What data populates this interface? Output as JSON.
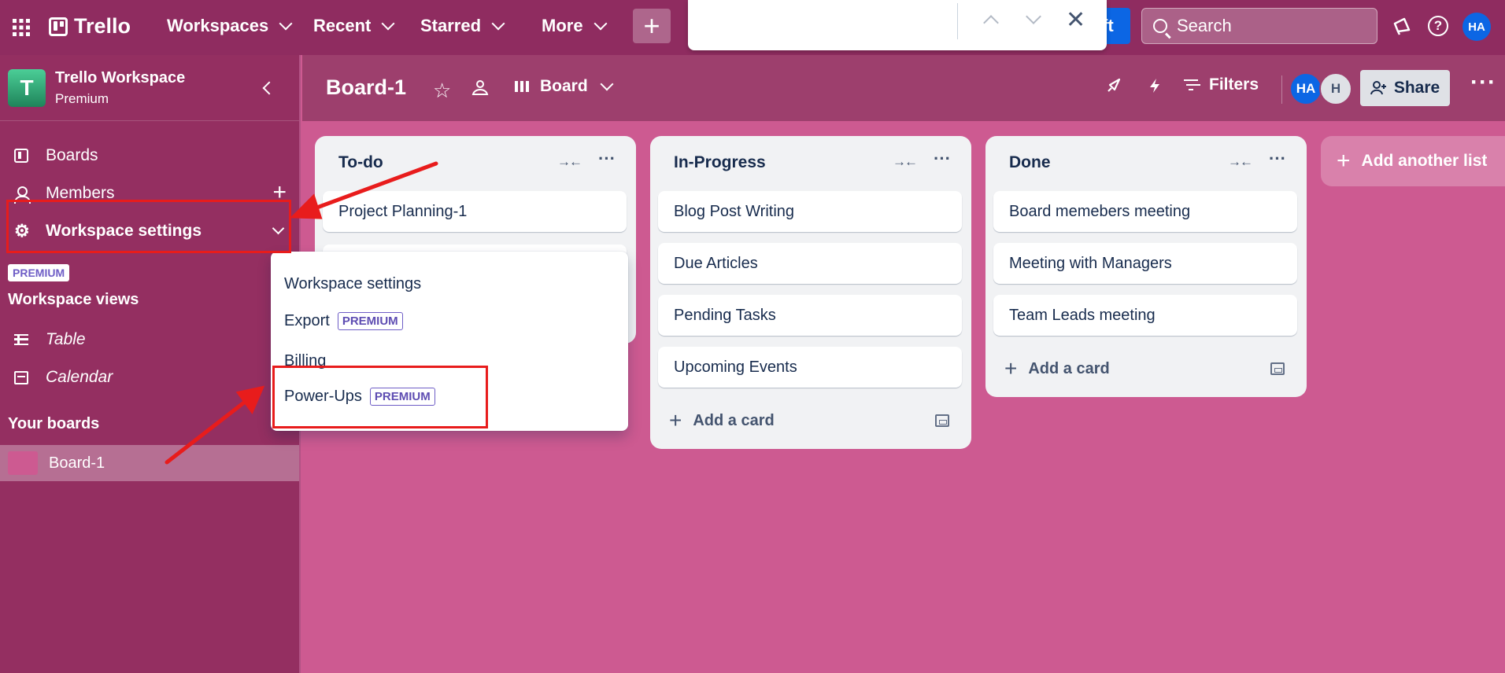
{
  "topbar": {
    "brand": "Trello",
    "menus": [
      "Workspaces",
      "Recent",
      "Starred",
      "More"
    ],
    "create_label": "+",
    "partial_button_text": "ft",
    "search_placeholder": "Search",
    "user_initials": "HA"
  },
  "sidebar": {
    "workspace_initial": "T",
    "workspace_name": "Trello Workspace",
    "workspace_plan": "Premium",
    "items": {
      "boards": "Boards",
      "members": "Members",
      "settings": "Workspace settings"
    },
    "premium_badge": "PREMIUM",
    "views_title": "Workspace views",
    "views": [
      "Table",
      "Calendar"
    ],
    "your_boards_title": "Your boards",
    "boards": [
      "Board-1"
    ]
  },
  "board": {
    "title": "Board-1",
    "view": "Board",
    "filters_label": "Filters",
    "members": [
      "HA",
      "H"
    ],
    "share_label": "Share",
    "lists": [
      {
        "title": "To-do",
        "cards": [
          "Project Planning-1"
        ]
      },
      {
        "title": "In-Progress",
        "cards": [
          "Blog Post Writing",
          "Due Articles",
          "Pending Tasks",
          "Upcoming Events"
        ],
        "add_label": "Add a card"
      },
      {
        "title": "Done",
        "cards": [
          "Board memebers meeting",
          "Meeting with Managers",
          "Team Leads meeting"
        ],
        "add_label": "Add a card"
      }
    ],
    "add_list_label": "Add another list"
  },
  "dropdown": {
    "items": [
      "Workspace settings",
      "Export",
      "Billing",
      "Power-Ups"
    ],
    "premium_label": "PREMIUM"
  },
  "colors": {
    "topbar": "#8f2c60",
    "sidebar": "#942f61",
    "board_bg": "#cd5a91",
    "annotation": "#e81c1c",
    "accent_blue": "#0c66e4"
  }
}
